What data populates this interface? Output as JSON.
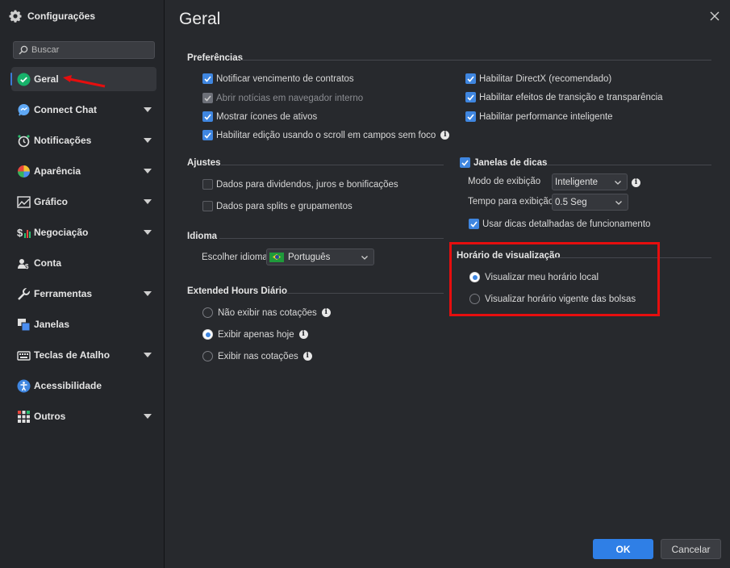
{
  "app": {
    "title": "Configurações"
  },
  "search": {
    "placeholder": "Buscar"
  },
  "sidebar": {
    "items": [
      {
        "label": "Geral",
        "icon": "check-circle-icon",
        "active": true,
        "expandable": false
      },
      {
        "label": "Connect Chat",
        "icon": "chat-icon",
        "expandable": true
      },
      {
        "label": "Notificações",
        "icon": "alarm-clock-icon",
        "expandable": true
      },
      {
        "label": "Aparência",
        "icon": "color-palette-icon",
        "expandable": true
      },
      {
        "label": "Gráfico",
        "icon": "chart-icon",
        "expandable": true
      },
      {
        "label": "Negociação",
        "icon": "dollar-chart-icon",
        "expandable": true
      },
      {
        "label": "Conta",
        "icon": "user-account-icon",
        "expandable": false
      },
      {
        "label": "Ferramentas",
        "icon": "wrench-icon",
        "expandable": true
      },
      {
        "label": "Janelas",
        "icon": "windows-icon",
        "expandable": false
      },
      {
        "label": "Teclas de Atalho",
        "icon": "keyboard-icon",
        "expandable": true
      },
      {
        "label": "Acessibilidade",
        "icon": "accessibility-icon",
        "expandable": false
      },
      {
        "label": "Outros",
        "icon": "grid-icon",
        "expandable": true
      }
    ]
  },
  "main": {
    "title": "Geral",
    "preferencias": {
      "title": "Preferências",
      "left": [
        {
          "label": "Notificar vencimento de contratos",
          "checked": true
        },
        {
          "label": "Abrir notícias em navegador interno",
          "checked": true,
          "disabled": true
        },
        {
          "label": "Mostrar ícones de ativos",
          "checked": true
        },
        {
          "label": "Habilitar edição usando o scroll em campos sem foco",
          "checked": true,
          "info": true
        }
      ],
      "right": [
        {
          "label": "Habilitar DirectX (recomendado)",
          "checked": true
        },
        {
          "label": "Habilitar efeitos de transição e transparência",
          "checked": true
        },
        {
          "label": "Habilitar performance inteligente",
          "checked": true
        }
      ]
    },
    "ajustes": {
      "title": "Ajustes",
      "items": [
        {
          "label": "Dados para dividendos, juros e bonificações",
          "checked": false
        },
        {
          "label": "Dados para splits e grupamentos",
          "checked": false
        }
      ]
    },
    "janelas_dicas": {
      "title": "Janelas de dicas",
      "checked": true,
      "modo_label": "Modo de exibição",
      "modo_value": "Inteligente",
      "tempo_label": "Tempo para exibição",
      "tempo_value": "0.5 Seg",
      "detalhadas": {
        "label": "Usar dicas detalhadas de funcionamento",
        "checked": true
      }
    },
    "idioma": {
      "title": "Idioma",
      "label": "Escolher idioma",
      "value": "Português"
    },
    "horario": {
      "title": "Horário de visualização",
      "options": [
        {
          "label": "Visualizar meu horário local",
          "selected": true
        },
        {
          "label": "Visualizar horário vigente das bolsas",
          "selected": false
        }
      ]
    },
    "extended": {
      "title": "Extended Hours Diário",
      "options": [
        {
          "label": "Não exibir nas cotações",
          "selected": false,
          "info": true
        },
        {
          "label": "Exibir apenas hoje",
          "selected": true,
          "info": true
        },
        {
          "label": "Exibir nas cotações",
          "selected": false,
          "info": true
        }
      ]
    }
  },
  "footer": {
    "ok_label": "OK",
    "cancel_label": "Cancelar"
  },
  "colors": {
    "accent": "#3f86e0",
    "highlight": "#e60e0e",
    "background": "#27292d",
    "sidebar": "#24262a"
  }
}
